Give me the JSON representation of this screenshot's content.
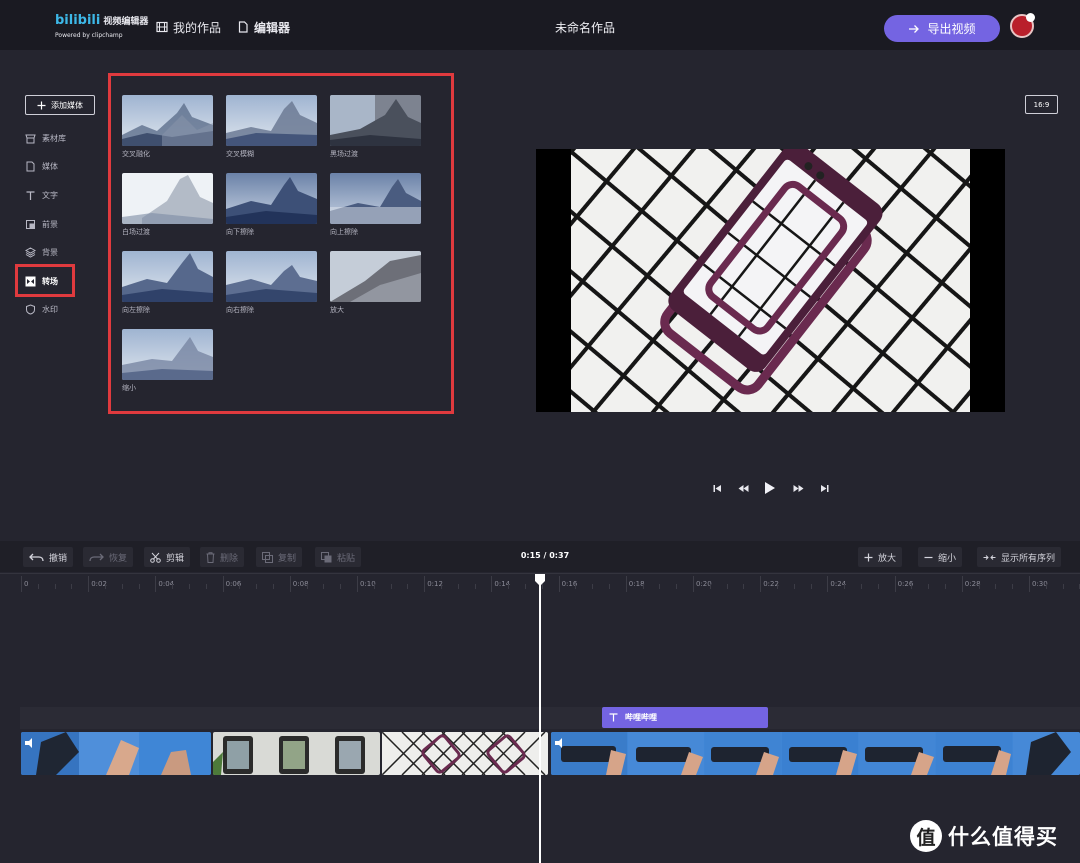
{
  "header": {
    "logo_main": "bilibili",
    "logo_sub_name": "视频编辑器",
    "logo_powered": "Powered by clipchamp",
    "nav_projects": "我的作品",
    "nav_editor": "编辑器",
    "document_title": "未命名作品",
    "export_label": "导出视频"
  },
  "sidebar": {
    "add_media": "添加媒体",
    "items": [
      {
        "label": "素材库",
        "icon": "store-icon"
      },
      {
        "label": "媒体",
        "icon": "file-icon"
      },
      {
        "label": "文字",
        "icon": "text-icon"
      },
      {
        "label": "前景",
        "icon": "foreground-icon"
      },
      {
        "label": "背景",
        "icon": "layers-icon"
      },
      {
        "label": "转场",
        "icon": "transition-icon",
        "active": true
      },
      {
        "label": "水印",
        "icon": "shield-icon"
      }
    ]
  },
  "transitions": [
    {
      "label": "交叉融化"
    },
    {
      "label": "交叉模糊"
    },
    {
      "label": "黑场过渡"
    },
    {
      "label": "白场过渡"
    },
    {
      "label": "向下擦除"
    },
    {
      "label": "向上擦除"
    },
    {
      "label": "向左擦除"
    },
    {
      "label": "向右擦除"
    },
    {
      "label": "放大"
    },
    {
      "label": "缩小"
    }
  ],
  "preview": {
    "aspect_ratio": "16:9"
  },
  "toolbar": {
    "undo": "撤销",
    "redo": "恢复",
    "cut": "剪辑",
    "delete": "删除",
    "copy": "复制",
    "paste": "粘贴",
    "time": "0:15 / 0:37",
    "zoom_in": "放大",
    "zoom_out": "缩小",
    "show_all": "显示所有序列"
  },
  "ruler_ticks": [
    "0",
    "0:02",
    "0:04",
    "0:06",
    "0:08",
    "0:10",
    "0:12",
    "0:14",
    "0:16",
    "0:18",
    "0:20",
    "0:22",
    "0:24",
    "0:26",
    "0:28",
    "0:30"
  ],
  "text_clip_label": "哔哩哔哩",
  "watermark": {
    "icon_char": "值",
    "text": "什么值得买"
  },
  "colors": {
    "accent": "#7464e2",
    "highlight": "#e03a3e",
    "background": "#25252f",
    "header": "#1a1a22"
  }
}
